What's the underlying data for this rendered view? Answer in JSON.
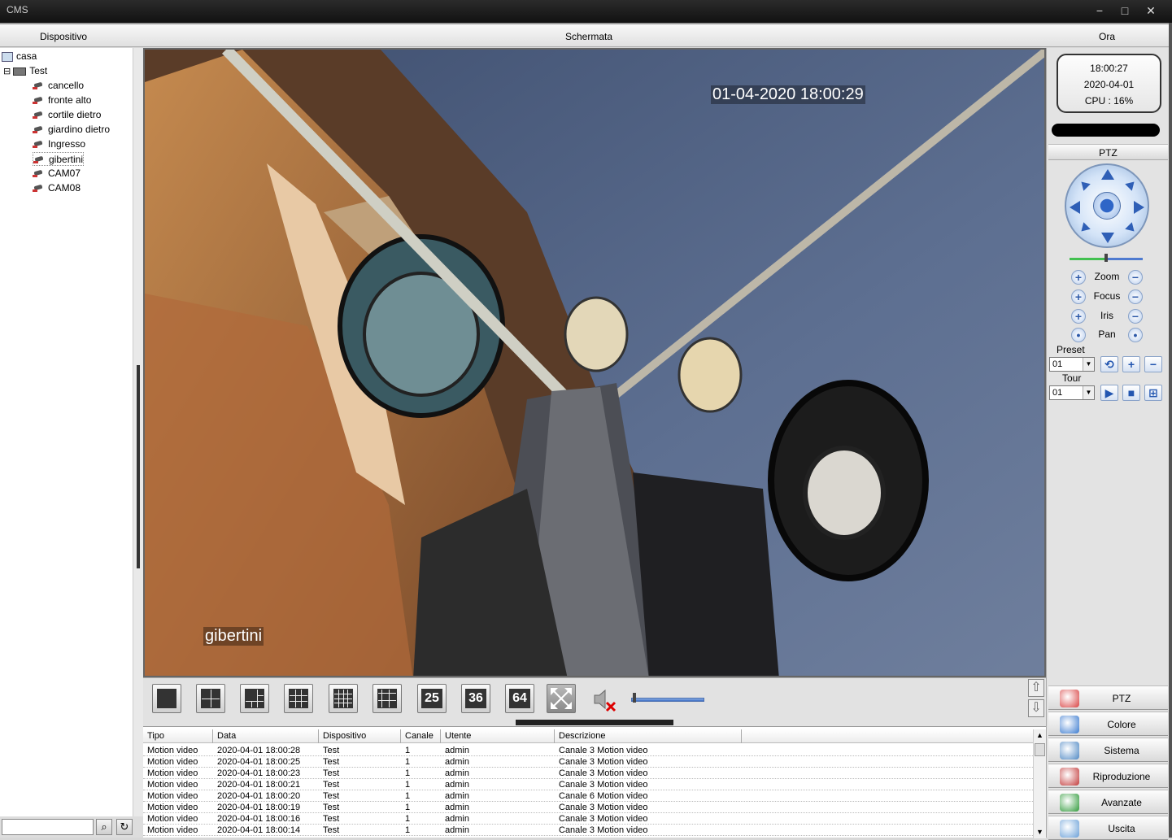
{
  "window": {
    "title": "CMS",
    "minimize": "−",
    "maximize": "□",
    "close": "✕"
  },
  "menu": {
    "device": "Dispositivo",
    "screen": "Schermata",
    "time": "Ora"
  },
  "tree": {
    "root": "casa",
    "group": "Test",
    "group_toggle": "⊟",
    "cameras": [
      "cancello",
      "fronte alto",
      "cortile dietro",
      "giardino dietro",
      "Ingresso",
      "gibertini",
      "CAM07",
      "CAM08"
    ]
  },
  "search": {
    "search_icon": "magnifier-icon",
    "refresh_icon": "refresh-icon"
  },
  "video": {
    "osd_datetime": "01-04-2020 18:00:29",
    "osd_channel": "gibertini"
  },
  "toolbar": {
    "layouts": [
      "1",
      "4",
      "6",
      "8",
      "9",
      "13",
      "16",
      "25",
      "36",
      "64"
    ],
    "layout_25": "25",
    "layout_36": "36",
    "layout_64": "64",
    "volume_level": 0.02
  },
  "log": {
    "columns": [
      "Tipo",
      "Data",
      "Dispositivo",
      "Canale",
      "Utente",
      "Descrizione"
    ],
    "rows": [
      [
        "Motion video",
        "2020-04-01 18:00:28",
        "Test",
        "1",
        "admin",
        "Canale 3 Motion video"
      ],
      [
        "Motion video",
        "2020-04-01 18:00:25",
        "Test",
        "1",
        "admin",
        "Canale 3 Motion video"
      ],
      [
        "Motion video",
        "2020-04-01 18:00:23",
        "Test",
        "1",
        "admin",
        "Canale 3 Motion video"
      ],
      [
        "Motion video",
        "2020-04-01 18:00:21",
        "Test",
        "1",
        "admin",
        "Canale 3 Motion video"
      ],
      [
        "Motion video",
        "2020-04-01 18:00:20",
        "Test",
        "1",
        "admin",
        "Canale 6 Motion video"
      ],
      [
        "Motion video",
        "2020-04-01 18:00:19",
        "Test",
        "1",
        "admin",
        "Canale 3 Motion video"
      ],
      [
        "Motion video",
        "2020-04-01 18:00:16",
        "Test",
        "1",
        "admin",
        "Canale 3 Motion video"
      ],
      [
        "Motion video",
        "2020-04-01 18:00:14",
        "Test",
        "1",
        "admin",
        "Canale 3 Motion video"
      ]
    ]
  },
  "status": {
    "time": "18:00:27",
    "date": "2020-04-01",
    "cpu": "CPU : 16%"
  },
  "ptz": {
    "header": "PTZ",
    "zoom": "Zoom",
    "focus": "Focus",
    "iris": "Iris",
    "pan": "Pan",
    "preset_label": "Preset",
    "preset_value": "01",
    "tour_label": "Tour",
    "tour_value": "01",
    "speed_level": 0.5
  },
  "side_menu": [
    {
      "label": "PTZ",
      "icon": "ptz-icon"
    },
    {
      "label": "Colore",
      "icon": "color-icon"
    },
    {
      "label": "Sistema",
      "icon": "system-icon"
    },
    {
      "label": "Riproduzione",
      "icon": "playback-icon"
    },
    {
      "label": "Avanzate",
      "icon": "advanced-icon"
    },
    {
      "label": "Uscita",
      "icon": "exit-icon"
    }
  ]
}
